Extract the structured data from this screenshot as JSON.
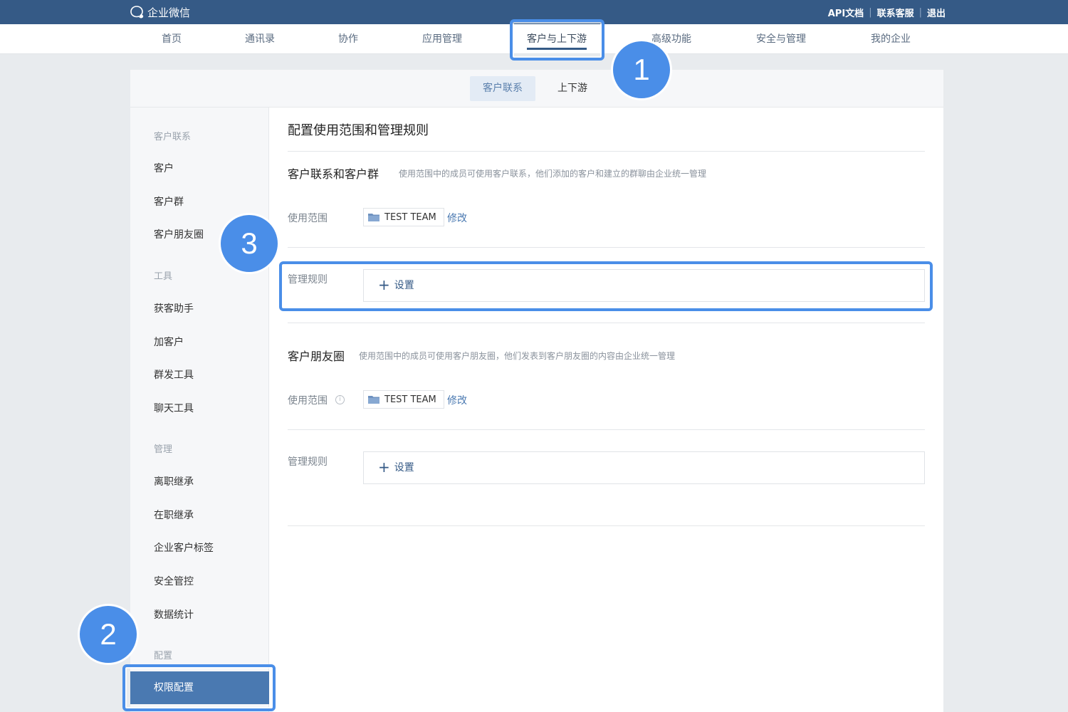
{
  "topbar": {
    "logo_text": "企业微信",
    "links": [
      "API文档",
      "联系客服",
      "退出"
    ],
    "color": "#355a86"
  },
  "mainnav": {
    "items": [
      {
        "label": "首页"
      },
      {
        "label": "通讯录"
      },
      {
        "label": "协作"
      },
      {
        "label": "应用管理"
      },
      {
        "label": "客户与上下游",
        "active": true
      },
      {
        "label": "高级功能"
      },
      {
        "label": "安全与管理"
      },
      {
        "label": "我的企业"
      }
    ]
  },
  "subnav": {
    "tabs": [
      {
        "label": "客户联系",
        "active": true
      },
      {
        "label": "上下游"
      }
    ]
  },
  "sidebar": {
    "groups": [
      {
        "heading": "客户联系",
        "items": [
          "客户",
          "客户群",
          "客户朋友圈"
        ]
      },
      {
        "heading": "工具",
        "items": [
          "获客助手",
          "加客户",
          "群发工具",
          "聊天工具"
        ]
      },
      {
        "heading": "管理",
        "items": [
          "离职继承",
          "在职继承",
          "企业客户标签",
          "安全管控",
          "数据统计"
        ]
      },
      {
        "heading": "配置",
        "items": [
          "权限配置"
        ]
      }
    ],
    "active_item": "权限配置",
    "active_color": "#4a79b1"
  },
  "main": {
    "page_title": "配置使用范围和管理规则",
    "sections": [
      {
        "title": "客户联系和客户群",
        "description": "使用范围中的成员可使用客户联系，他们添加的客户和建立的群聊由企业统一管理",
        "scope_label": "使用范围",
        "scope_value": "TEST TEAM",
        "edit_label": "修改",
        "rules_label": "管理规则",
        "rules_button": "设置"
      },
      {
        "title": "客户朋友圈",
        "description": "使用范围中的成员可使用客户朋友圈，他们发表到客户朋友圈的内容由企业统一管理",
        "scope_label": "使用范围",
        "scope_info_icon": "info-icon",
        "scope_value": "TEST TEAM",
        "edit_label": "修改",
        "rules_label": "管理规则",
        "rules_button": "设置"
      }
    ]
  },
  "annotations": {
    "badges": [
      "1",
      "2",
      "3"
    ],
    "highlight_color": "#4a8ee8"
  }
}
